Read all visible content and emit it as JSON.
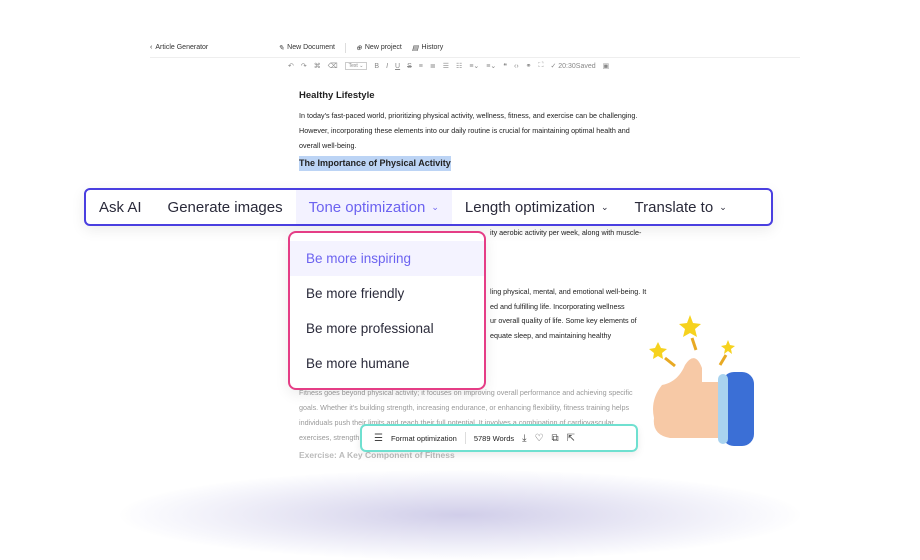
{
  "topbar": {
    "back": "Article Generator",
    "new_document": "New Document",
    "new_project": "New project",
    "history": "History"
  },
  "toolbar": {
    "style_select": "Text",
    "saved": "20:30Saved"
  },
  "document": {
    "title": "Healthy Lifestyle",
    "intro": [
      "In today's fast-paced world, prioritizing physical activity, wellness, fitness, and exercise can be challenging.",
      "However, incorporating these elements into our daily routine is crucial for maintaining optimal health and",
      "overall well-being."
    ],
    "heading1": "The Importance of Physical Activity",
    "fragment1": "ity aerobic activity per week, along with muscle-",
    "fragments2": [
      "ling physical, mental, and emotional well-being. It",
      "ed and fulfilling life. Incorporating wellness",
      "ur overall quality of life. Some key elements of",
      "equate sleep, and maintaining healthy"
    ],
    "fitness": [
      "Fitness goes beyond physical activity; it focuses on improving overall performance and achieving specific",
      "goals. Whether it's building strength, increasing endurance, or enhancing flexibility, fitness training helps",
      "individuals push their limits and reach their full potential. It involves a combination of cardiovascular",
      "exercises, strength"
    ],
    "heading2": "Exercise: A Key Component of Fitness"
  },
  "ai_bar": {
    "items": [
      "Ask AI",
      "Generate images",
      "Tone optimization",
      "Length optimization",
      "Translate to"
    ],
    "active": "Tone optimization"
  },
  "tone_menu": {
    "items": [
      "Be more inspiring",
      "Be more friendly",
      "Be more professional",
      "Be more humane"
    ],
    "selected": "Be more inspiring"
  },
  "format_bar": {
    "label": "Format optimization",
    "word_count": "5789 Words"
  },
  "colors": {
    "accent": "#4a3fe0",
    "active_text": "#6c63f0",
    "menu_border": "#e53d86",
    "format_border": "#6fe0d0"
  }
}
